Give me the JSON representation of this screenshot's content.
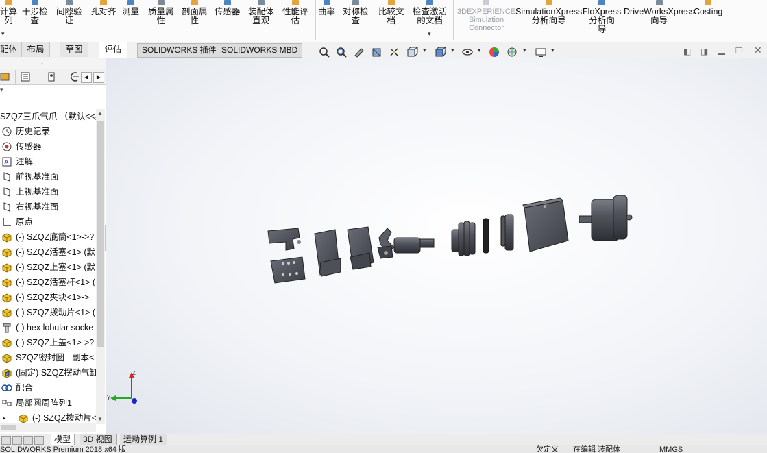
{
  "ribbon": {
    "buttons": [
      {
        "label": "计算\n列",
        "icon": "calculate-icon"
      },
      {
        "label": "干涉检\n查",
        "icon": "interference-icon"
      },
      {
        "label": "间隙验\n证",
        "icon": "clearance-icon"
      },
      {
        "label": "孔对齐",
        "icon": "hole-align-icon"
      },
      {
        "label": "测量",
        "icon": "measure-icon"
      },
      {
        "label": "质量属\n性",
        "icon": "mass-properties-icon"
      },
      {
        "label": "剖面属\n性",
        "icon": "section-properties-icon"
      },
      {
        "label": "传感器",
        "icon": "sensor-icon"
      },
      {
        "label": "装配体\n直观",
        "icon": "assembly-visualization-icon"
      },
      {
        "label": "性能评\n估",
        "icon": "performance-icon"
      },
      {
        "label": "曲率",
        "icon": "curvature-icon"
      },
      {
        "label": "对称检\n查",
        "icon": "symmetry-icon"
      },
      {
        "label": "比较文\n档",
        "icon": "compare-icon"
      },
      {
        "label": "检查激活\n的文档",
        "icon": "check-document-icon"
      },
      {
        "label": "3DEXPERIENCE\nSimulation\nConnector",
        "icon": "3dx-icon"
      },
      {
        "label": "SimulationXpress\n分析向导",
        "icon": "simulationxpress-icon"
      },
      {
        "label": "FloXpress\n分析向\n导",
        "icon": "floxpress-icon"
      },
      {
        "label": "DriveWorksXpress\n向导",
        "icon": "driveworks-icon"
      },
      {
        "label": "Costing",
        "icon": "costing-icon"
      }
    ]
  },
  "command_tabs": [
    "配体",
    "布局",
    "草图",
    "评估",
    "SOLIDWORKS 插件",
    "SOLIDWORKS MBD"
  ],
  "feature_tree": {
    "root": "SZQZ三爪气爪 （默认<<默",
    "items": [
      {
        "label": "历史记录",
        "icon": "history-icon"
      },
      {
        "label": "传感器",
        "icon": "sensor-icon"
      },
      {
        "label": "注解",
        "icon": "annotation-icon"
      },
      {
        "label": "前视基准面",
        "icon": "plane-icon"
      },
      {
        "label": "上视基准面",
        "icon": "plane-icon"
      },
      {
        "label": "右视基准面",
        "icon": "plane-icon"
      },
      {
        "label": "原点",
        "icon": "origin-icon"
      },
      {
        "label": "(-) SZQZ底筒<1>->?",
        "icon": "part-icon"
      },
      {
        "label": "(-) SZQZ活塞<1> (默",
        "icon": "part-icon"
      },
      {
        "label": "(-) SZQZ上塞<1> (默",
        "icon": "part-icon"
      },
      {
        "label": "(-) SZQZ活塞杆<1> (",
        "icon": "part-icon"
      },
      {
        "label": "(-) SZQZ夹块<1>->",
        "icon": "part-icon"
      },
      {
        "label": "(-) SZQZ拨动片<1> (",
        "icon": "part-icon"
      },
      {
        "label": "(-) hex lobular socke",
        "icon": "screw-icon"
      },
      {
        "label": "(-) SZQZ上盖<1>->?",
        "icon": "part-icon"
      },
      {
        "label": "SZQZ密封圈 - 副本<",
        "icon": "part-icon"
      },
      {
        "label": "(固定) SZQZ摆动气缸",
        "icon": "subassembly-icon"
      },
      {
        "label": "配合",
        "icon": "mates-icon"
      },
      {
        "label": "局部圆周阵列1",
        "icon": "pattern-icon"
      },
      {
        "label": "(-) SZQZ拨动片<",
        "icon": "part-icon"
      }
    ]
  },
  "triad": {
    "x": "Y",
    "y": "Z"
  },
  "bottom_tabs": [
    "模型",
    "3D 视图",
    "运动算例 1"
  ],
  "status": {
    "app": "SOLIDWORKS Premium 2018 x64 版",
    "define": "欠定义",
    "editing": "在编辑 装配体",
    "units": "MMGS"
  },
  "colors": {
    "part": "#4a4d55",
    "part_light": "#6b6e77",
    "accent": "#1a4fa0"
  }
}
